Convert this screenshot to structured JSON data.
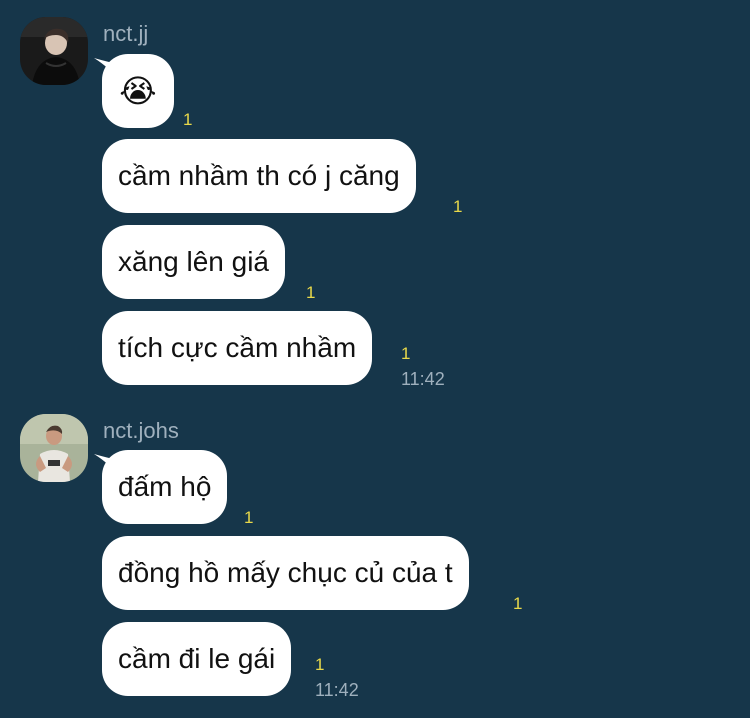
{
  "groups": [
    {
      "sender": "nct.jj",
      "avatar_icon": "profile-photo-dark",
      "messages": [
        {
          "text": "😭",
          "unread": "1"
        },
        {
          "text": "cầm nhầm th có j căng",
          "unread": "1"
        },
        {
          "text": "xăng lên giá",
          "unread": "1"
        },
        {
          "text": "tích cực cầm nhầm",
          "unread": "1"
        }
      ],
      "time": "11:42"
    },
    {
      "sender": "nct.johs",
      "avatar_icon": "profile-photo-light",
      "messages": [
        {
          "text": "đấm hộ",
          "unread": "1"
        },
        {
          "text": "đồng hồ mấy chục củ của t",
          "unread": "1"
        },
        {
          "text": "cầm đi le gái",
          "unread": "1"
        }
      ],
      "time": "11:42"
    }
  ],
  "colors": {
    "background": "#16364a",
    "bubble": "#ffffff",
    "unread": "#e8d84a",
    "meta_text": "#9fb0bd"
  }
}
